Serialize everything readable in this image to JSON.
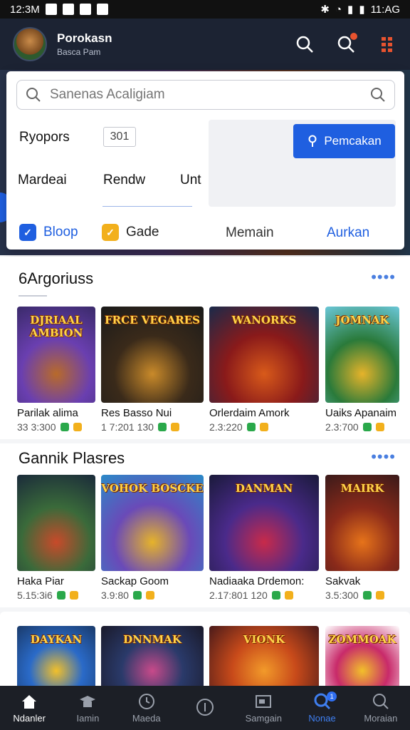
{
  "status_bar": {
    "time_left": "12:3M",
    "time_right": "11:AG"
  },
  "header": {
    "title": "Porokasn",
    "subtitle": "Basca Pam"
  },
  "search": {
    "placeholder": "Sanenas Acaligiam"
  },
  "filters": {
    "row1_label": "Ryopors",
    "row1_value": "301",
    "row2_items": [
      "Mardeai",
      "Rendw",
      "Unt"
    ],
    "action_button": "Pemcakan",
    "tags": [
      {
        "label": "Bloop",
        "icon": "check-icon",
        "color": "#1f5fe0"
      },
      {
        "label": "Gade",
        "icon": "check-icon",
        "color": "#f2b01c"
      },
      {
        "label": "Memain"
      },
      {
        "label": "Aurkan"
      }
    ]
  },
  "sections": [
    {
      "title": "6Argoriuss",
      "items": [
        {
          "thumb_text": "DJRIAAL AMBION",
          "title": "Parilak alima",
          "meta": "33 3:300",
          "colors": [
            "#6a3fb0",
            "#b86a2a",
            "#3a2a6a"
          ]
        },
        {
          "thumb_text": "FRCE VEGARES",
          "title": "Res Basso Nui",
          "meta": "1 7:201 130",
          "colors": [
            "#3a2a1a",
            "#c98a2a",
            "#1a1a1a"
          ]
        },
        {
          "thumb_text": "WANORKS",
          "title": "Orlerdaim Amork",
          "meta": "2.3:220",
          "colors": [
            "#8a1a1a",
            "#d85a1a",
            "#1a2a4a"
          ]
        },
        {
          "thumb_text": "JOMNAK",
          "title": "Uaiks Apanaim",
          "meta": "2.3:700",
          "colors": [
            "#2a7a3a",
            "#e6b32a",
            "#6ac7d8"
          ]
        }
      ]
    },
    {
      "title": "Gannik Plasres",
      "items": [
        {
          "thumb_text": "",
          "title": "Haka Piar",
          "meta": "5.15:3i6",
          "colors": [
            "#3a6a3a",
            "#c84a2a",
            "#1a2a3a"
          ]
        },
        {
          "thumb_text": "VOHOK BOSCKE",
          "title": "Sackap Goom",
          "meta": "3.9:80",
          "colors": [
            "#6a4ab8",
            "#e6b32a",
            "#2a8ac8"
          ]
        },
        {
          "thumb_text": "DANMAN",
          "title": "Nadiaaka Drdemon:",
          "meta": "2.17:801 120",
          "colors": [
            "#4a2a8a",
            "#c82a4a",
            "#1a1a3a"
          ]
        },
        {
          "thumb_text": "MAIRK",
          "title": "Sakvak",
          "meta": "3.5:300",
          "colors": [
            "#8a2a1a",
            "#e6731a",
            "#3a1a1a"
          ]
        }
      ]
    },
    {
      "title": "",
      "items": [
        {
          "thumb_text": "DAYKAN",
          "colors": [
            "#2a6ac8",
            "#f2c02a",
            "#1a3a6a"
          ]
        },
        {
          "thumb_text": "DNNMAK",
          "colors": [
            "#2a3a6a",
            "#c84a8a",
            "#1a1a2a"
          ]
        },
        {
          "thumb_text": "VIONK",
          "colors": [
            "#c84a1a",
            "#f29a2a",
            "#4a1a1a"
          ]
        },
        {
          "thumb_text": "ZOMMOAK",
          "colors": [
            "#c82a6a",
            "#f2c02a",
            "#ffffff"
          ]
        }
      ]
    }
  ],
  "bottom_nav": [
    {
      "label": "Ndanler",
      "icon": "home-icon",
      "state": "active-home"
    },
    {
      "label": "Iamin",
      "icon": "graduation-cap-icon"
    },
    {
      "label": "Maeda",
      "icon": "clock-icon"
    },
    {
      "label": "",
      "icon": "compass-icon"
    },
    {
      "label": "Samgain",
      "icon": "window-icon"
    },
    {
      "label": "Nonae",
      "icon": "chat-search-icon",
      "state": "active-blue",
      "badge": "1"
    },
    {
      "label": "Moraian",
      "icon": "search-icon"
    }
  ]
}
